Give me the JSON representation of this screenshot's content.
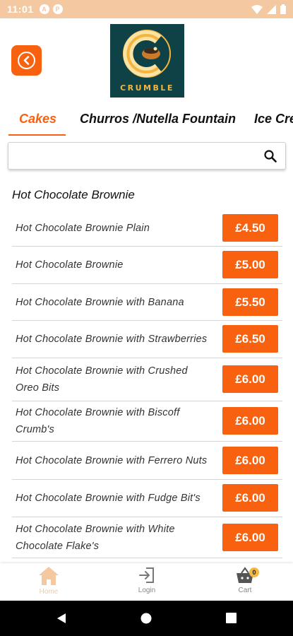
{
  "status_bar": {
    "time": "11:01",
    "notifications": [
      "A",
      "P"
    ]
  },
  "logo": {
    "text": "CRUMBLE"
  },
  "tabs": [
    {
      "label": "Cakes",
      "active": true
    },
    {
      "label": "Churros /Nutella Fountain",
      "active": false
    },
    {
      "label": "Ice Cream",
      "active": false
    }
  ],
  "search": {
    "value": "",
    "placeholder": ""
  },
  "section": {
    "title": "Hot Chocolate Brownie"
  },
  "items": [
    {
      "name": "Hot Chocolate Brownie Plain",
      "price": "£4.50"
    },
    {
      "name": "Hot Chocolate Brownie",
      "price": "£5.00"
    },
    {
      "name": "Hot Chocolate Brownie with Banana",
      "price": "£5.50"
    },
    {
      "name": "Hot Chocolate Brownie with Strawberries",
      "price": "£6.50"
    },
    {
      "name": "Hot Chocolate Brownie with Crushed Oreo Bits",
      "price": "£6.00"
    },
    {
      "name": "Hot Chocolate Brownie with Biscoff Crumb's",
      "price": "£6.00"
    },
    {
      "name": "Hot Chocolate Brownie with Ferrero Nuts",
      "price": "£6.00"
    },
    {
      "name": "Hot Chocolate Brownie with Fudge Bit's",
      "price": "£6.00"
    },
    {
      "name": "Hot Chocolate Brownie with White Chocolate Flake's",
      "price": "£6.00"
    }
  ],
  "bottom_nav": {
    "home": {
      "label": "Home",
      "icon": "home-icon"
    },
    "login": {
      "label": "Login",
      "icon": "login-icon"
    },
    "cart": {
      "label": "Cart",
      "icon": "basket-icon",
      "badge": "0"
    }
  },
  "colors": {
    "accent": "#f7610f",
    "status_bar": "#f4c9a2",
    "logo_bg": "#0e4247",
    "logo_gold": "#f3b53d"
  }
}
